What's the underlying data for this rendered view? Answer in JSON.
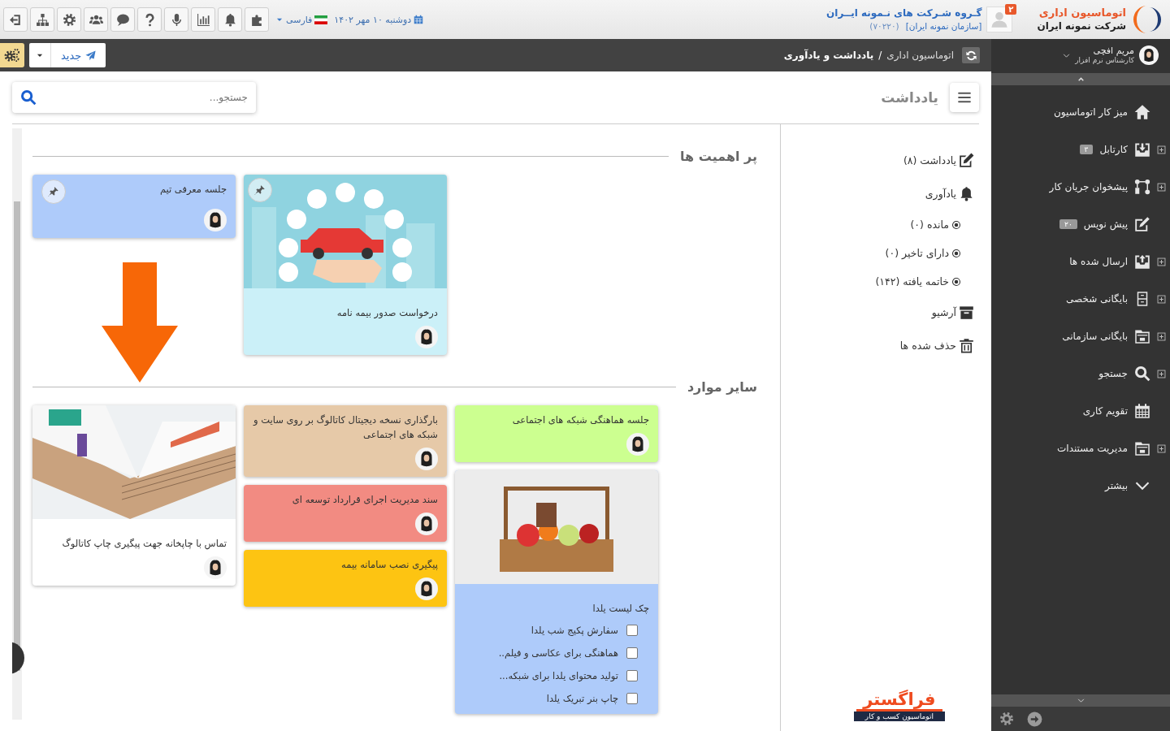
{
  "header": {
    "app_name": "اتوماسیون اداری",
    "company_name": "شرکت نمونه ایران",
    "org_badge": "۲",
    "org_title": "گـروه شـرکت های نـمونه ایــران",
    "org_code": "(۷۰۲۲۰)",
    "org_unit": "[سازمان نمونه ایران]",
    "date": "دوشنبه ۱۰ مهر ۱۴۰۲",
    "language": "فارسی"
  },
  "user": {
    "name": "مریم افچی",
    "role": "کارشناس نرم افزار"
  },
  "breadcrumb": {
    "items": [
      "اتوماسیون اداری",
      "یادداشت و یادآوری"
    ],
    "separator": "/"
  },
  "toolbar": {
    "new_button": "جدید"
  },
  "sidebar": {
    "items": [
      {
        "label": "میز کار اتوماسیون",
        "expandable": false
      },
      {
        "label": "کارتابل",
        "badge": "۳",
        "expandable": true
      },
      {
        "label": "پیشخوان جریان کار",
        "expandable": true
      },
      {
        "label": "پیش نویس",
        "badge": "۲۰",
        "expandable": false
      },
      {
        "label": "ارسال شده ها",
        "expandable": true
      },
      {
        "label": "بایگانی شخصی",
        "expandable": true
      },
      {
        "label": "بایگانی سازمانی",
        "expandable": true
      },
      {
        "label": "جستجو",
        "expandable": true
      },
      {
        "label": "تقویم کاری",
        "expandable": false
      },
      {
        "label": "مدیریت مستندات",
        "expandable": true
      },
      {
        "label": "بیشتر",
        "expandable": false
      }
    ]
  },
  "page": {
    "title": "یادداشت",
    "search": {
      "placeholder": "جستجو..."
    }
  },
  "nav": [
    {
      "kind": "link",
      "label": "یادداشت (۸)"
    },
    {
      "kind": "link",
      "label": "یادآوری"
    },
    {
      "kind": "filter",
      "label": "مانده (۰)"
    },
    {
      "kind": "filter",
      "label": "دارای تاخیر (۰)"
    },
    {
      "kind": "filter",
      "label": "خاتمه یافته (۱۴۲)"
    },
    {
      "kind": "link",
      "label": "آرشیو"
    },
    {
      "kind": "link",
      "label": "حذف شده ها"
    }
  ],
  "brand": {
    "name": "فراگستر",
    "tagline": "اتوماسیون کسب و کار"
  },
  "sections": [
    {
      "title": "پر اهمیت ها",
      "columns": [
        [
          {
            "kind": "car-photo",
            "title": "درخواست صدور بیمه نامه",
            "color": "#cbf0f8",
            "pinned": true,
            "avatar": true
          }
        ],
        [
          {
            "kind": "note",
            "title": "جلسه معرفی تیم",
            "color": "#aecbfa",
            "pinned": true,
            "avatar": true
          }
        ]
      ]
    },
    {
      "title": "سایر موارد",
      "columns": [
        [
          {
            "kind": "note",
            "title": "جلسه هماهنگی شبکه های اجتماعی",
            "color": "#ccff90",
            "pinned": false,
            "avatar": true
          },
          {
            "kind": "basket-photo",
            "title": "چک لیست یلدا",
            "color": "#aecbfa",
            "pinned": false,
            "avatar": false,
            "checklist": [
              {
                "label": "سفارش پکیج شب یلدا",
                "checked": false
              },
              {
                "label": "هماهنگی برای عکاسی و فیلم..",
                "checked": false
              },
              {
                "label": "تولید محتوای یلدا برای شبکه...",
                "checked": false
              },
              {
                "label": "چاپ بنر تبریک یلدا",
                "checked": false
              }
            ]
          }
        ],
        [
          {
            "kind": "note",
            "title": "بارگذاری نسخه دیجیتال کاتالوگ بر روی سایت و شبکه های اجتماعی",
            "color": "#e6c9a8",
            "pinned": false,
            "avatar": true
          },
          {
            "kind": "note",
            "title": "سند مدیریت اجرای قرارداد توسعه ای",
            "color": "#f28b82",
            "pinned": false,
            "avatar": true
          },
          {
            "kind": "note",
            "title": "پیگیری نصب سامانه بیمه",
            "color": "#fdc412",
            "pinned": false,
            "avatar": true
          }
        ],
        [
          {
            "kind": "catalog-photo",
            "title": "تماس با چاپخانه جهت پیگیری چاپ کاتالوگ",
            "color": "#ffffff",
            "pinned": false,
            "avatar": true
          }
        ]
      ]
    }
  ]
}
